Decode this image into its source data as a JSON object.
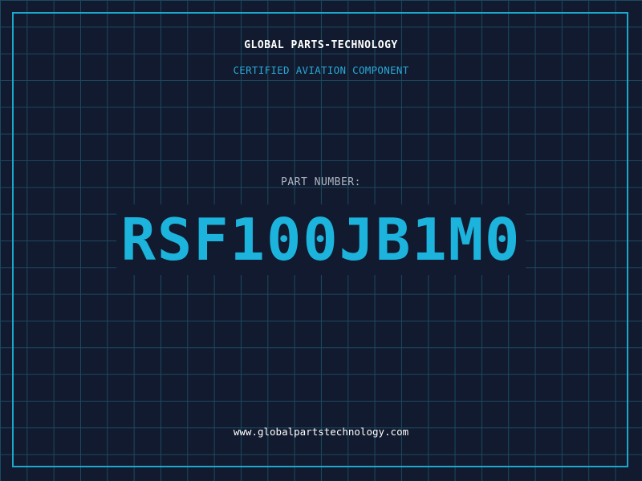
{
  "header": {
    "company": "GLOBAL PARTS-TECHNOLOGY",
    "subtitle": "CERTIFIED AVIATION COMPONENT"
  },
  "part": {
    "label": "PART NUMBER:",
    "number": "RSF100JB1M0"
  },
  "footer": {
    "url": "www.globalpartstechnology.com"
  },
  "colors": {
    "background": "#111a2e",
    "grid": "#1b4a60",
    "border": "#1fa6cc",
    "accent": "#1cb3dd",
    "subtitle": "#2aa9d8",
    "label": "#aeb7c4",
    "text": "#ffffff"
  }
}
